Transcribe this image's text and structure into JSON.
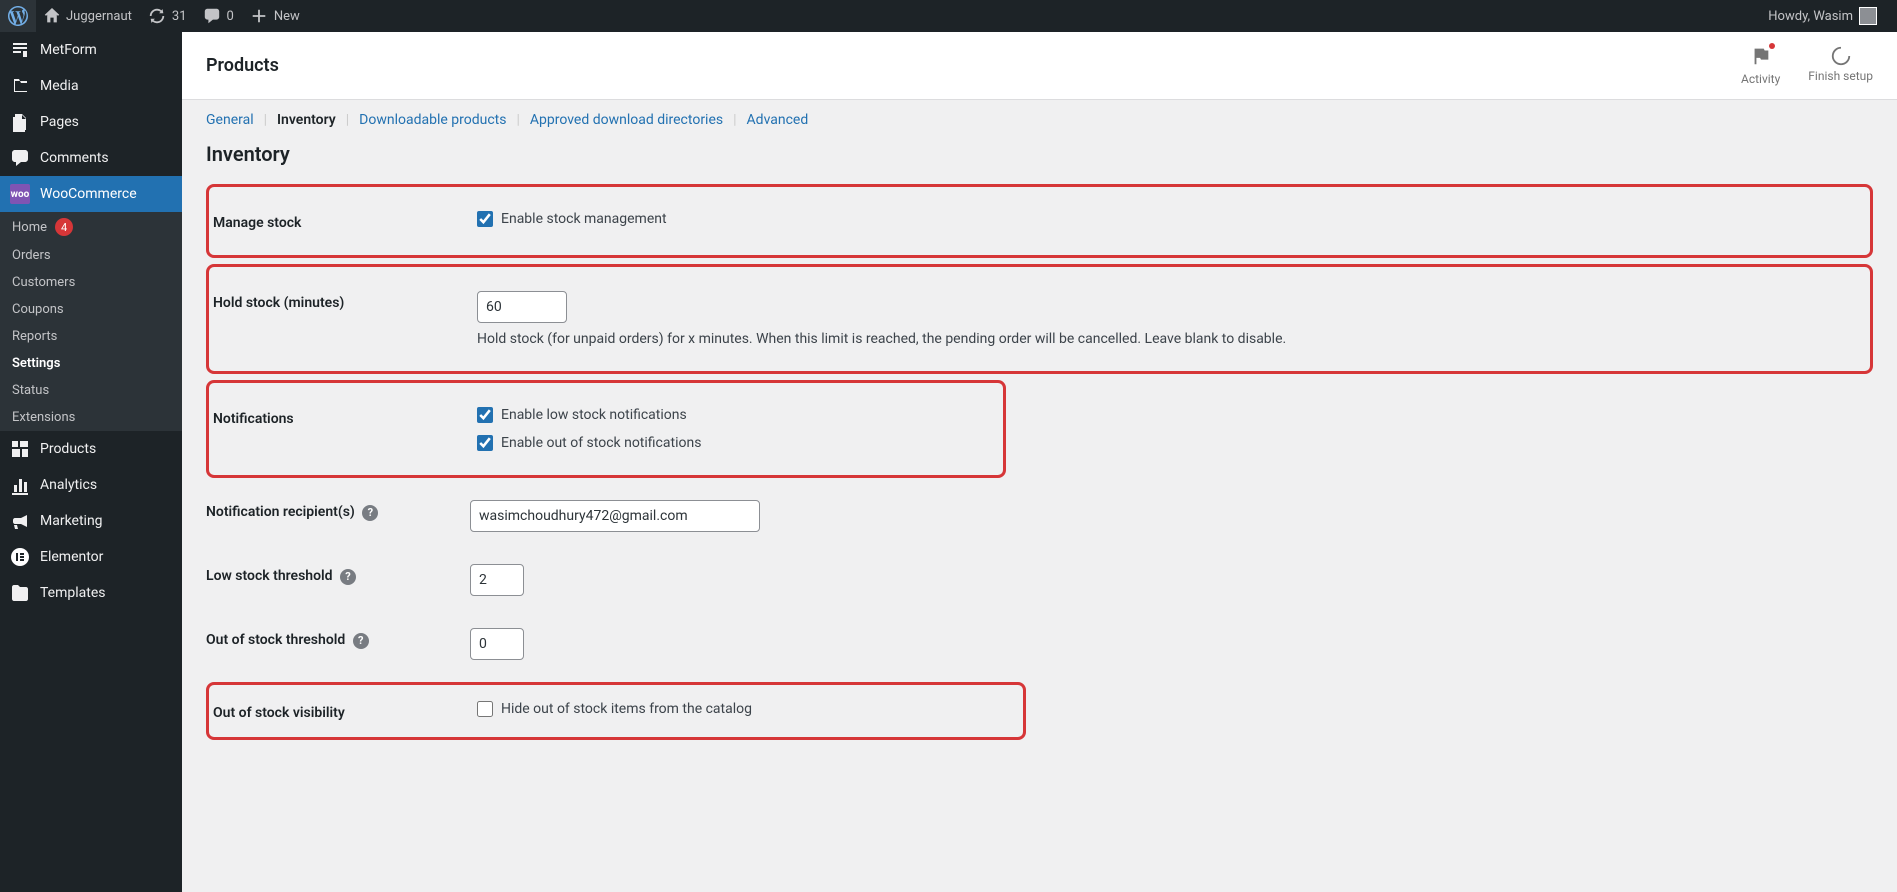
{
  "admin_bar": {
    "site_name": "Juggernaut",
    "updates": "31",
    "comments": "0",
    "new_label": "New",
    "howdy": "Howdy, Wasim"
  },
  "sidebar": {
    "items": [
      {
        "label": "MetForm",
        "icon": "metform"
      },
      {
        "label": "Media",
        "icon": "media"
      },
      {
        "label": "Pages",
        "icon": "pages"
      },
      {
        "label": "Comments",
        "icon": "comments"
      }
    ],
    "woo_label": "WooCommerce",
    "woo_submenu": [
      {
        "label": "Home",
        "badge": "4"
      },
      {
        "label": "Orders"
      },
      {
        "label": "Customers"
      },
      {
        "label": "Coupons"
      },
      {
        "label": "Reports"
      },
      {
        "label": "Settings",
        "current": true
      },
      {
        "label": "Status"
      },
      {
        "label": "Extensions"
      }
    ],
    "bottom_items": [
      {
        "label": "Products",
        "icon": "products"
      },
      {
        "label": "Analytics",
        "icon": "analytics"
      },
      {
        "label": "Marketing",
        "icon": "marketing"
      },
      {
        "label": "Elementor",
        "icon": "elementor"
      },
      {
        "label": "Templates",
        "icon": "templates"
      }
    ]
  },
  "header": {
    "title": "Products",
    "activity": "Activity",
    "finish_setup": "Finish setup"
  },
  "subtabs": {
    "general": "General",
    "inventory": "Inventory",
    "downloadable": "Downloadable products",
    "approved_dirs": "Approved download directories",
    "advanced": "Advanced"
  },
  "settings": {
    "section_title": "Inventory",
    "manage_stock": {
      "label": "Manage stock",
      "checkbox_label": "Enable stock management"
    },
    "hold_stock": {
      "label": "Hold stock (minutes)",
      "value": "60",
      "help": "Hold stock (for unpaid orders) for x minutes. When this limit is reached, the pending order will be cancelled. Leave blank to disable."
    },
    "notifications": {
      "label": "Notifications",
      "low": "Enable low stock notifications",
      "out": "Enable out of stock notifications"
    },
    "recipient": {
      "label": "Notification recipient(s)",
      "value": "wasimchoudhury472@gmail.com"
    },
    "low_threshold": {
      "label": "Low stock threshold",
      "value": "2"
    },
    "out_threshold": {
      "label": "Out of stock threshold",
      "value": "0"
    },
    "visibility": {
      "label": "Out of stock visibility",
      "checkbox_label": "Hide out of stock items from the catalog"
    }
  }
}
